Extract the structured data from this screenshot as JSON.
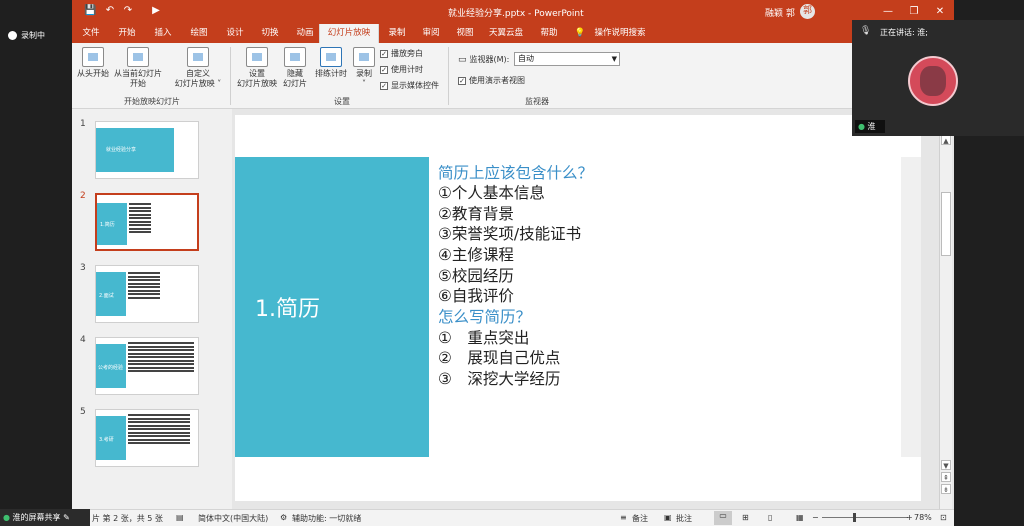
{
  "recording": {
    "label": "录制中"
  },
  "window": {
    "doc_title": "就业经验分享.pptx - PowerPoint",
    "user": "融颖 郭",
    "user_initial": "郭",
    "minimize": "—",
    "restore": "❐",
    "close": "✕"
  },
  "quick_access": {
    "save": "💾",
    "undo": "↶",
    "redo": "↷",
    "present": "▶"
  },
  "tabs": [
    "文件",
    "开始",
    "插入",
    "绘图",
    "设计",
    "切换",
    "动画",
    "幻灯片放映",
    "录制",
    "审阅",
    "视图",
    "天翼云盘",
    "帮助",
    "操作说明搜索"
  ],
  "ribbon": {
    "from_beginning": "从头开始",
    "from_current": [
      "从当前幻灯片",
      "开始"
    ],
    "custom_show": [
      "自定义",
      "幻灯片放映 ˅"
    ],
    "group_start": "开始放映幻灯片",
    "setup": [
      "设置",
      "幻灯片放映"
    ],
    "hide": [
      "隐藏",
      "幻灯片"
    ],
    "rehearse": "排练计时",
    "record": [
      "录制",
      "˅"
    ],
    "checks": [
      "播放旁白",
      "使用计时",
      "显示媒体控件"
    ],
    "group_setup": "设置",
    "monitor_label": "监视器(M):",
    "monitor_value": "自动",
    "presenter_view": "使用演示者视图",
    "group_monitor": "监视器"
  },
  "thumbnails": [
    {
      "num": "1",
      "title": "就业经验分享"
    },
    {
      "num": "2",
      "title": "1.简历"
    },
    {
      "num": "3",
      "title": "2.面试"
    },
    {
      "num": "4",
      "title": "公考的经验"
    },
    {
      "num": "5",
      "title": "3.考研"
    }
  ],
  "slide": {
    "title": "1.简历",
    "q1": "简历上应该包含什么？",
    "items1": [
      "①个人基本信息",
      "②教育背景",
      "③荣誉奖项/技能证书",
      "④主修课程",
      "⑤校园经历",
      "⑥自我评价"
    ],
    "q2": "怎么写简历？",
    "items2": [
      "①　重点突出",
      "②　展现自己优点",
      "③　深挖大学经历"
    ]
  },
  "status": {
    "slide_info": "片 第 2 张，共 5 张",
    "language": "简体中文(中国大陆)",
    "accessibility": "辅助功能: 一切就绪",
    "notes": "备注",
    "comments": "批注",
    "zoom": "78%"
  },
  "share": {
    "label": "淮的屏幕共享"
  },
  "video": {
    "speaking": "正在讲话:  淮;",
    "name": "淮"
  }
}
